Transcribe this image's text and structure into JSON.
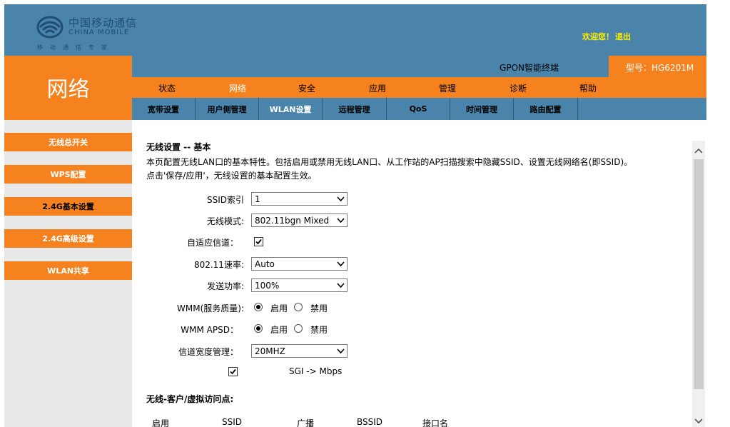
{
  "header": {
    "logo_cn": "中国移动通信",
    "logo_en": "CHINA MOBILE",
    "logo_slogan": "移动通信专家",
    "welcome": "欢迎您！",
    "logout": "退出",
    "product_name": "GPON智能终端",
    "model": "型号：HG6201M"
  },
  "section_title": "网络",
  "main_nav": [
    "状态",
    "网络",
    "安全",
    "应用",
    "管理",
    "诊断",
    "帮助"
  ],
  "sub_nav": [
    "宽带设置",
    "用户侧管理",
    "WLAN设置",
    "远程管理",
    "QoS",
    "时间管理",
    "路由配置"
  ],
  "sidebar": [
    "无线总开关",
    "WPS配置",
    "2.4G基本设置",
    "2.4G高级设置",
    "WLAN共享"
  ],
  "content": {
    "heading": "无线设置 -- 基本",
    "desc_line1": "本页配置无线LAN口的基本特性。包括启用或禁用无线LAN口、从工作站的AP扫描搜索中隐藏SSID、设置无线网络名(即SSID)。",
    "desc_line2": "点击'保存/应用'，无线设置的基本配置生效。",
    "ssid_index_label": "SSID索引",
    "ssid_index_value": "1",
    "wireless_mode_label": "无线模式:",
    "wireless_mode_value": "802.11bgn Mixed",
    "auto_channel_label": "自适应信道：",
    "auto_channel_checked": true,
    "rate_label": "802.11速率:",
    "rate_value": "Auto",
    "tx_power_label": "发送功率:",
    "tx_power_value": "100%",
    "wmm_label": "WMM(服务质量):",
    "wmm_apsd_label": "WMM APSD：",
    "enable_label": "启用",
    "disable_label": "禁用",
    "channel_width_label": "信道宽度管理：",
    "channel_width_value": "20MHZ",
    "sgi_label": "SGI -> Mbps",
    "sgi_checked": true,
    "client_heading": "无线-客户/虚拟访问点:",
    "table_headers": [
      "启用",
      "SSID",
      "广播",
      "BSSID",
      "接口名"
    ]
  },
  "colors": {
    "header_blue": "#4a84ab",
    "orange": "#f5821f",
    "sidebar_bg": "#e8e8e8",
    "welcome_yellow": "#ffef00"
  }
}
